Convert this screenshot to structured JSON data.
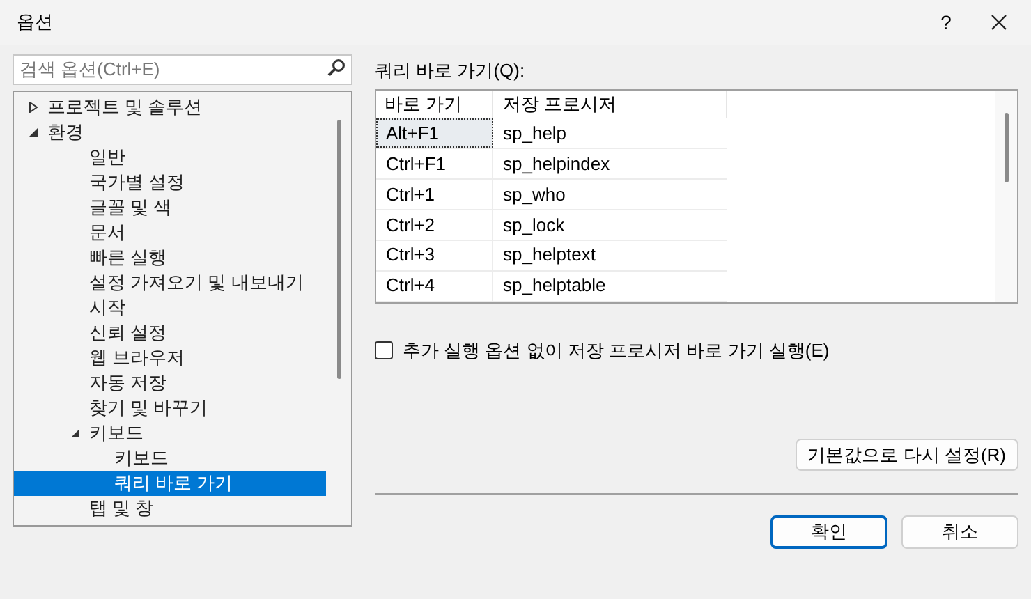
{
  "window": {
    "title": "옵션",
    "help": "?"
  },
  "search": {
    "placeholder": "검색 옵션(Ctrl+E)"
  },
  "tree": [
    {
      "label": "프로젝트 및 솔루션",
      "expanded": false,
      "selected": false
    },
    {
      "label": "환경",
      "expanded": true,
      "selected": false,
      "children": [
        {
          "label": "일반",
          "selected": false
        },
        {
          "label": "국가별 설정",
          "selected": false
        },
        {
          "label": "글꼴 및 색",
          "selected": false
        },
        {
          "label": "문서",
          "selected": false
        },
        {
          "label": "빠른 실행",
          "selected": false
        },
        {
          "label": "설정 가져오기 및 내보내기",
          "selected": false
        },
        {
          "label": "시작",
          "selected": false
        },
        {
          "label": "신뢰 설정",
          "selected": false
        },
        {
          "label": "웹 브라우저",
          "selected": false
        },
        {
          "label": "자동 저장",
          "selected": false
        },
        {
          "label": "찾기 및 바꾸기",
          "selected": false
        },
        {
          "label": "키보드",
          "expanded": true,
          "selected": false,
          "children": [
            {
              "label": "키보드",
              "selected": false
            },
            {
              "label": "쿼리 바로 가기",
              "selected": true
            }
          ]
        },
        {
          "label": "탭 및 창",
          "selected": false
        }
      ]
    }
  ],
  "shortcuts": {
    "label": "쿼리 바로 가기(Q):",
    "columns": [
      "바로 가기",
      "저장 프로시저"
    ],
    "rows": [
      {
        "shortcut": "Alt+F1",
        "procedure": "sp_help",
        "selected": true
      },
      {
        "shortcut": "Ctrl+F1",
        "procedure": "sp_helpindex",
        "selected": false
      },
      {
        "shortcut": "Ctrl+1",
        "procedure": "sp_who",
        "selected": false
      },
      {
        "shortcut": "Ctrl+2",
        "procedure": "sp_lock",
        "selected": false
      },
      {
        "shortcut": "Ctrl+3",
        "procedure": "sp_helptext",
        "selected": false
      },
      {
        "shortcut": "Ctrl+4",
        "procedure": "sp_helptable",
        "selected": false
      }
    ]
  },
  "option": {
    "label": "추가 실행 옵션 없이 저장 프로시저 바로 가기 실행(E)",
    "checked": false
  },
  "reset_button": "기본값으로 다시 설정(R)",
  "buttons": [
    {
      "label": "확인",
      "kind": "primary"
    },
    {
      "label": "취소",
      "kind": "secondary"
    }
  ]
}
